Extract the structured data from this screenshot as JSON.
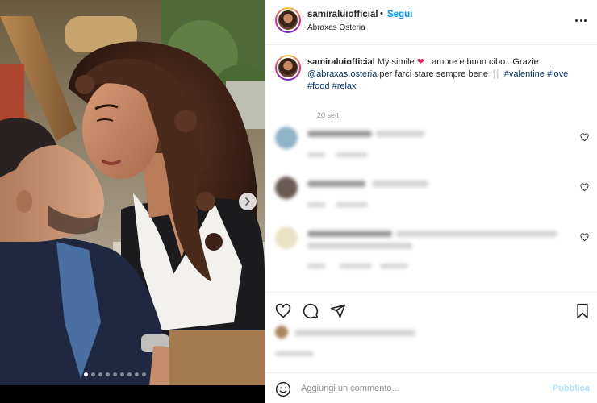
{
  "post": {
    "username": "samiraluiofficial",
    "separator": "•",
    "follow_label": "Segui",
    "location": "Abraxas Osteria",
    "more_icon": "more-horizontal-icon"
  },
  "caption": {
    "username": "samiraluiofficial",
    "text_before": "My simile.",
    "emoji_heart": "❤",
    "text_middle": " ..amore e buon cibo.. Grazie ",
    "mention": "@abraxas.osteria",
    "text_after": " per farci stare sempre bene ",
    "emoji_cutlery": "🍴",
    "hashtags": [
      "#valentine",
      "#love",
      "#food",
      "#relax"
    ],
    "date": "20 sett."
  },
  "actions": {
    "like_icon": "heart-icon",
    "comment_icon": "comment-icon",
    "share_icon": "share-icon",
    "save_icon": "bookmark-icon"
  },
  "add_comment": {
    "emoji_icon": "emoji-icon",
    "placeholder": "Aggiungi un commento...",
    "publish_label": "Pubblica"
  },
  "carousel": {
    "slide_count": 9,
    "active_index": 0
  },
  "colors": {
    "accent": "#0095f6",
    "link": "#00376b",
    "publish_disabled": "#b2dffc",
    "muted": "#8e8e8e",
    "text": "#262626"
  }
}
